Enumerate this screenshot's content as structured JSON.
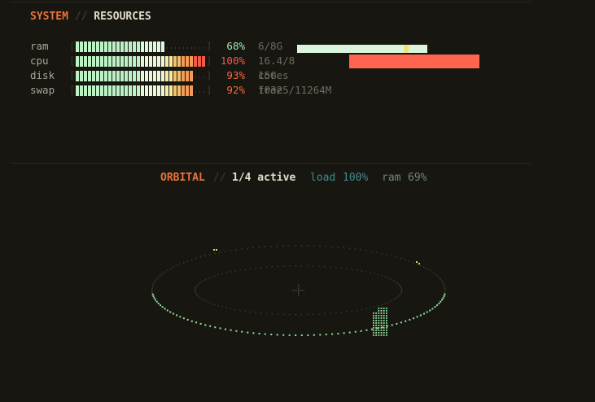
{
  "system": {
    "title": "SYSTEM",
    "separator": "//",
    "subtitle": "RESOURCES",
    "rows": [
      {
        "name": "ram",
        "percent": "68%",
        "detail": "6/8G",
        "fraction": 0.68,
        "pct_color": "#9ee8ae"
      },
      {
        "name": "cpu",
        "percent": "100%",
        "detail": "16.4/8 cores",
        "fraction": 1.0,
        "pct_color": "#f05a45"
      },
      {
        "name": "disk",
        "percent": "93%",
        "detail": "15G free",
        "fraction": 0.93,
        "pct_color": "#f06a3e"
      },
      {
        "name": "swap",
        "percent": "92%",
        "detail": "10325/11264M",
        "fraction": 0.92,
        "pct_color": "#f06a3e"
      }
    ],
    "mini_bars": [
      {
        "name": "ram",
        "fraction": 1.0,
        "color": "#d9f6dc",
        "marker": 0.82,
        "marker_color": "#f3e27a"
      },
      {
        "name": "cpu",
        "fraction": 1.0,
        "color": "#ff6450"
      }
    ]
  },
  "orbital": {
    "title": "ORBITAL",
    "separator": "//",
    "active": "1/4 active",
    "load_label": "load",
    "load_value": "100%",
    "ram_label": "ram",
    "ram_value": "69%"
  },
  "colors": {
    "background": "#181611",
    "accent": "#e8743a",
    "green": "#9ee8ae",
    "teal": "#3e8c8c"
  }
}
